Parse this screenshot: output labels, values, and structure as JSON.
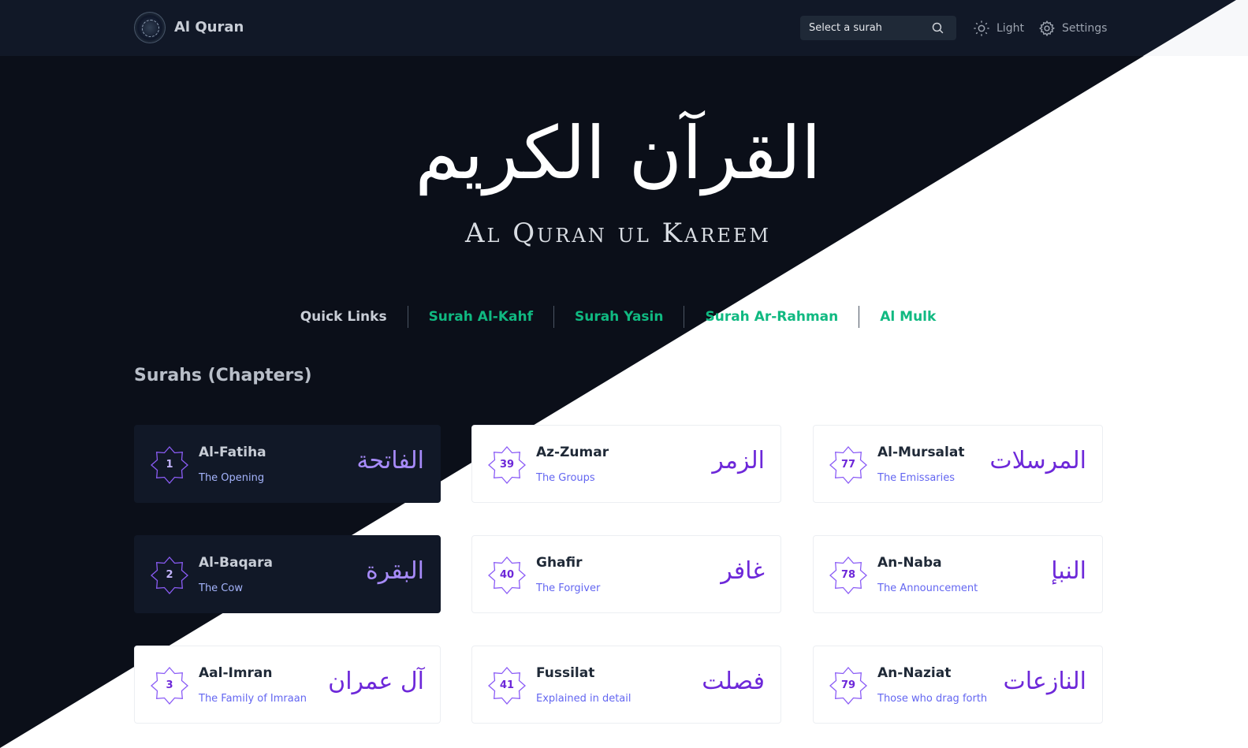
{
  "navbar": {
    "brand": "Al Quran",
    "search": {
      "placeholder": "Select a surah"
    },
    "theme_label": "Light",
    "settings_label": "Settings"
  },
  "hero": {
    "arabic": "القرآن الكريم",
    "title": "Al Quran ul Kareem"
  },
  "quick_links": {
    "label": "Quick Links",
    "links": [
      "Surah Al-Kahf",
      "Surah Yasin",
      "Surah Ar-Rahman",
      "Al Mulk"
    ]
  },
  "surahs_section": {
    "title": "Surahs (Chapters)",
    "cards": [
      {
        "number": "1",
        "name": "Al-Fatiha",
        "meaning": "The Opening",
        "arabic": "الفاتحة"
      },
      {
        "number": "39",
        "name": "Az-Zumar",
        "meaning": "The Groups",
        "arabic": "الزمر"
      },
      {
        "number": "77",
        "name": "Al-Mursalat",
        "meaning": "The Emissaries",
        "arabic": "المرسلات"
      },
      {
        "number": "2",
        "name": "Al-Baqara",
        "meaning": "The Cow",
        "arabic": "البقرة"
      },
      {
        "number": "40",
        "name": "Ghafir",
        "meaning": "The Forgiver",
        "arabic": "غافر"
      },
      {
        "number": "78",
        "name": "An-Naba",
        "meaning": "The Announcement",
        "arabic": "النبإ"
      },
      {
        "number": "3",
        "name": "Aal-Imran",
        "meaning": "The Family of Imraan",
        "arabic": "آل عمران"
      },
      {
        "number": "41",
        "name": "Fussilat",
        "meaning": "Explained in detail",
        "arabic": "فصلت"
      },
      {
        "number": "79",
        "name": "An-Naziat",
        "meaning": "Those who drag forth",
        "arabic": "النازعات"
      }
    ]
  },
  "colors": {
    "dark_bg": "#0b0f19",
    "accent_green": "#10b981",
    "accent_purple": "#6d28d9",
    "meaning_blue": "#6366f1"
  },
  "icons": [
    "logo",
    "search-icon",
    "sun-icon",
    "gear-icon",
    "star-badge-icon"
  ]
}
